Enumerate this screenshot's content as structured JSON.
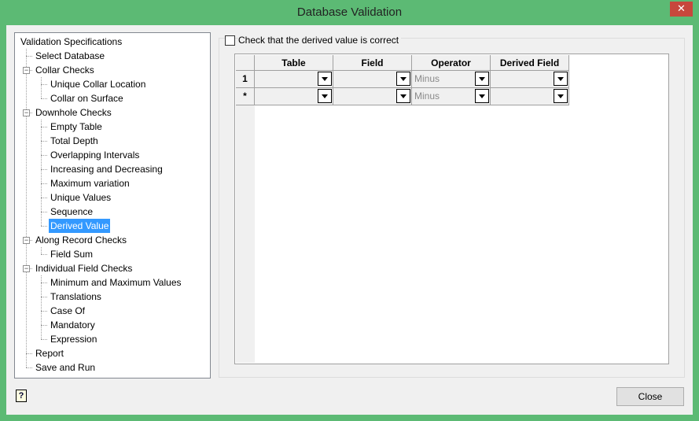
{
  "window": {
    "title": "Database Validation",
    "close_glyph": "✕"
  },
  "tree": {
    "items": [
      {
        "label": "Validation Specifications",
        "level": 0
      },
      {
        "label": "Select Database",
        "level": 1
      },
      {
        "label": "Collar Checks",
        "level": 1,
        "expander": "minus"
      },
      {
        "label": "Unique Collar Location",
        "level": 2
      },
      {
        "label": "Collar on Surface",
        "level": 2
      },
      {
        "label": "Downhole Checks",
        "level": 1,
        "expander": "minus"
      },
      {
        "label": "Empty Table",
        "level": 2
      },
      {
        "label": "Total Depth",
        "level": 2
      },
      {
        "label": "Overlapping Intervals",
        "level": 2
      },
      {
        "label": "Increasing and Decreasing",
        "level": 2
      },
      {
        "label": "Maximum variation",
        "level": 2
      },
      {
        "label": "Unique Values",
        "level": 2
      },
      {
        "label": "Sequence",
        "level": 2
      },
      {
        "label": "Derived Value",
        "level": 2,
        "selected": true
      },
      {
        "label": "Along Record Checks",
        "level": 1,
        "expander": "minus"
      },
      {
        "label": "Field Sum",
        "level": 2
      },
      {
        "label": "Individual Field Checks",
        "level": 1,
        "expander": "minus"
      },
      {
        "label": "Minimum and Maximum Values",
        "level": 2
      },
      {
        "label": "Translations",
        "level": 2
      },
      {
        "label": "Case Of",
        "level": 2
      },
      {
        "label": "Mandatory",
        "level": 2
      },
      {
        "label": "Expression",
        "level": 2
      },
      {
        "label": "Report",
        "level": 1
      },
      {
        "label": "Save and Run",
        "level": 1
      }
    ]
  },
  "panel": {
    "checkbox_label": "Check that the derived value is correct",
    "checked": false
  },
  "grid": {
    "columns": [
      "Table",
      "Field",
      "Operator",
      "Derived Field"
    ],
    "rows": [
      {
        "num": "1",
        "cells": [
          "",
          "",
          "Minus",
          ""
        ]
      },
      {
        "num": "*",
        "cells": [
          "",
          "",
          "Minus",
          ""
        ]
      }
    ]
  },
  "footer": {
    "close_label": "Close",
    "help_glyph": "?"
  }
}
